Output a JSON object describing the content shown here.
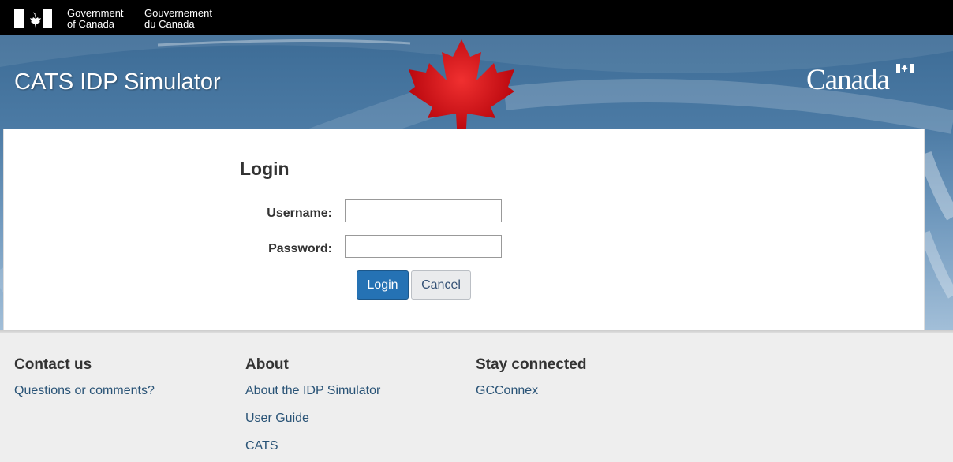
{
  "goc": {
    "en_line1": "Government",
    "en_line2": "of Canada",
    "fr_line1": "Gouvernement",
    "fr_line2": "du Canada"
  },
  "header": {
    "site_title": "CATS IDP Simulator",
    "wordmark": "Canada"
  },
  "login": {
    "heading": "Login",
    "username_label": "Username:",
    "username_value": "",
    "password_label": "Password:",
    "password_value": "",
    "login_button": "Login",
    "cancel_button": "Cancel"
  },
  "footer": {
    "columns": [
      {
        "heading": "Contact us",
        "links": [
          "Questions or comments?"
        ]
      },
      {
        "heading": "About",
        "links": [
          "About the IDP Simulator",
          "User Guide",
          "CATS"
        ]
      },
      {
        "heading": "Stay connected",
        "links": [
          "GCConnex"
        ]
      }
    ]
  },
  "colors": {
    "primary_button": "#2572b4",
    "link": "#295376",
    "maple_red": "#d3080c",
    "goc_bar": "#000000"
  }
}
